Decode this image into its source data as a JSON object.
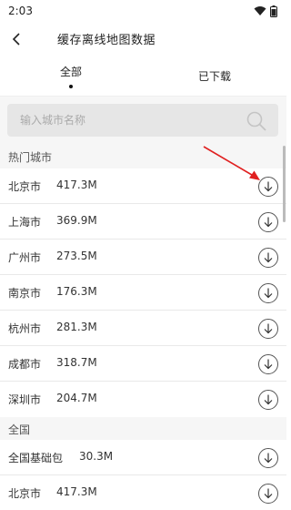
{
  "status": {
    "time": "2:03"
  },
  "header": {
    "title": "缓存离线地图数据"
  },
  "tabs": [
    {
      "label": "全部"
    },
    {
      "label": "已下载"
    }
  ],
  "search": {
    "placeholder": "输入城市名称"
  },
  "hot_section": {
    "title": "热门城市",
    "items": [
      {
        "name": "北京市",
        "size": "417.3M"
      },
      {
        "name": "上海市",
        "size": "369.9M"
      },
      {
        "name": "广州市",
        "size": "273.5M"
      },
      {
        "name": "南京市",
        "size": "176.3M"
      },
      {
        "name": "杭州市",
        "size": "281.3M"
      },
      {
        "name": "成都市",
        "size": "318.7M"
      },
      {
        "name": "深圳市",
        "size": "204.7M"
      }
    ]
  },
  "national_section": {
    "title": "全国",
    "items": [
      {
        "name": "全国基础包",
        "size": "30.3M"
      },
      {
        "name": "北京市",
        "size": "417.3M"
      }
    ]
  },
  "colors": {
    "annotation_arrow": "#e02020",
    "search_bg": "#e6e6e6",
    "list_bg": "#f6f6f6"
  },
  "icons": {
    "back": "chevron-left-icon",
    "search": "search-icon",
    "download": "download-arrow-icon",
    "wifi": "wifi-icon",
    "battery": "battery-icon"
  }
}
